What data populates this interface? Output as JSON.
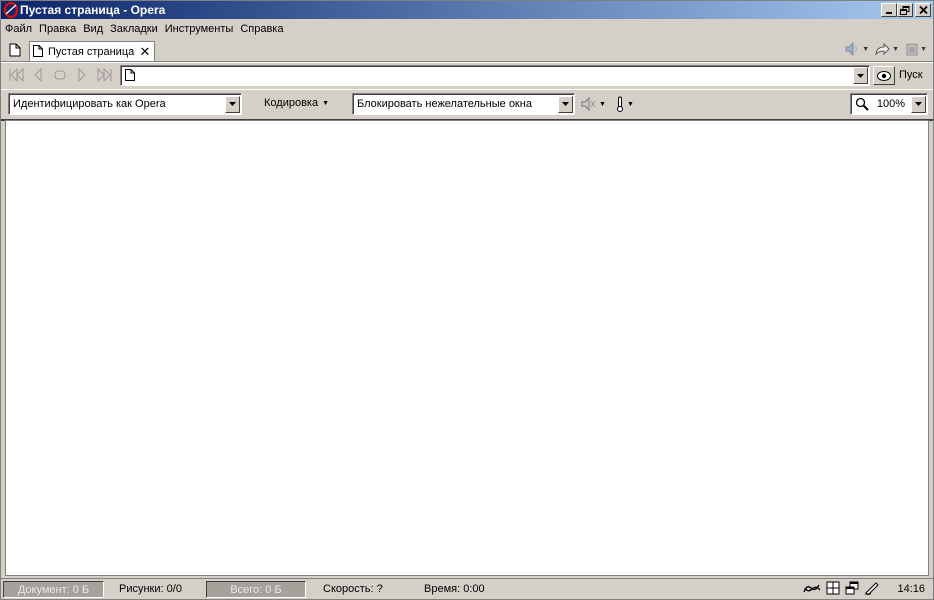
{
  "window": {
    "title": "Пустая страница - Opera",
    "min_label": "_",
    "max_label": "❐",
    "close_label": "✕"
  },
  "menu": [
    {
      "label": "Файл"
    },
    {
      "label": "Правка"
    },
    {
      "label": "Вид"
    },
    {
      "label": "Закладки"
    },
    {
      "label": "Инструменты"
    },
    {
      "label": "Справка"
    }
  ],
  "tabs": [
    {
      "label": "Пустая страница",
      "close_label": "✕"
    }
  ],
  "nav": {
    "address_value": "",
    "go_label": "Пуск"
  },
  "personal": {
    "identify_label": "Идентифицировать как Opera",
    "encoding_label": "Кодировка",
    "popup_label": "Блокировать нежелательные окна",
    "zoom_label": "100%"
  },
  "status": {
    "document_label": "Документ:",
    "document_value": "0 Б",
    "images_label": "Рисунки:",
    "images_value": "0/0",
    "total_label": "Всего:",
    "total_value": "0 Б",
    "speed_label": "Скорость:",
    "speed_value": "?",
    "time_label": "Время:",
    "time_value": "0:00",
    "clock": "14:16"
  },
  "colors": {
    "titlebar_start": "#0a246a",
    "titlebar_end": "#a6caf0",
    "chrome": "#d4d0c8",
    "opera_red": "#cc1111"
  }
}
